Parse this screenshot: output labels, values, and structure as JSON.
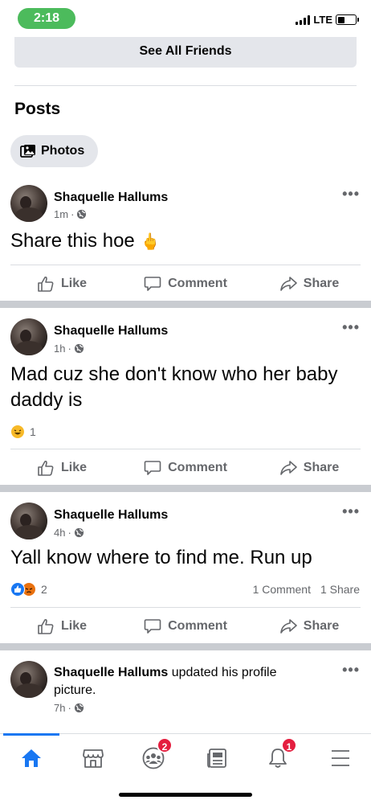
{
  "status_bar": {
    "time": "2:18",
    "network": "LTE"
  },
  "friends": {
    "see_all_label": "See All Friends"
  },
  "posts_section": {
    "title": "Posts",
    "photos_chip": "Photos"
  },
  "posts": [
    {
      "author": "Shaquelle Hallums",
      "time": "1m",
      "text": "Share this hoe",
      "emoji": "🖕",
      "reaction_count": "",
      "comments": "",
      "shares": ""
    },
    {
      "author": "Shaquelle Hallums",
      "time": "1h",
      "text": "Mad cuz she don't know who her baby daddy is",
      "reaction_count": "1",
      "comments": "",
      "shares": ""
    },
    {
      "author": "Shaquelle Hallums",
      "time": "4h",
      "text": "Yall know where to find me. Run up",
      "reaction_count": "2",
      "comments": "1 Comment",
      "shares": "1 Share"
    },
    {
      "author": "Shaquelle Hallums",
      "action_text": "updated his profile picture.",
      "time": "7h"
    }
  ],
  "post_actions": {
    "like": "Like",
    "comment": "Comment",
    "share": "Share"
  },
  "bottom_nav": {
    "items": [
      {
        "icon": "home-icon",
        "active": true
      },
      {
        "icon": "marketplace-icon"
      },
      {
        "icon": "groups-icon",
        "badge": "2"
      },
      {
        "icon": "news-feed-icon"
      },
      {
        "icon": "notifications-icon",
        "badge": "1"
      },
      {
        "icon": "menu-icon"
      }
    ]
  },
  "colors": {
    "accent": "#1877f2",
    "badge": "#e41e3f",
    "time_pill": "#4cbb5c",
    "secondary_text": "#65676b"
  }
}
